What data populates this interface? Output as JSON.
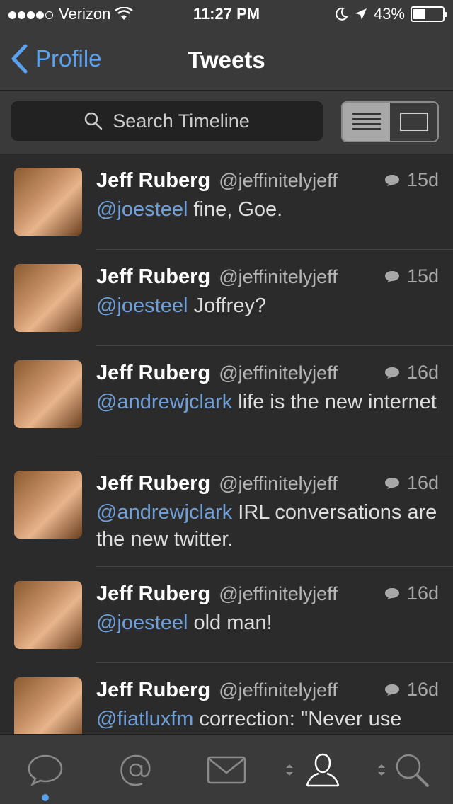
{
  "status_bar": {
    "carrier": "Verizon",
    "time": "11:27 PM",
    "battery": "43%",
    "battery_level": 0.43,
    "icons": [
      "signal-dots-icon",
      "wifi-icon",
      "moon-icon",
      "location-arrow-icon",
      "battery-icon"
    ]
  },
  "nav": {
    "back_label": "Profile",
    "title": "Tweets"
  },
  "search": {
    "placeholder": "Search Timeline"
  },
  "view_toggle": {
    "selected": "list"
  },
  "tweets": [
    {
      "name": "Jeff Ruberg",
      "handle": "@jeffinitelyjeff",
      "time": "15d",
      "mention": "@joesteel",
      "text": " fine, Goe."
    },
    {
      "name": "Jeff Ruberg",
      "handle": "@jeffinitelyjeff",
      "time": "15d",
      "mention": "@joesteel",
      "text": " Joffrey?"
    },
    {
      "name": "Jeff Ruberg",
      "handle": "@jeffinitelyjeff",
      "time": "16d",
      "mention": "@andrewjclark",
      "text": " life is the new internet"
    },
    {
      "name": "Jeff Ruberg",
      "handle": "@jeffinitelyjeff",
      "time": "16d",
      "mention": "@andrewjclark",
      "text": " IRL conversations are the new twitter."
    },
    {
      "name": "Jeff Ruberg",
      "handle": "@jeffinitelyjeff",
      "time": "16d",
      "mention": "@joesteel",
      "text": " old man!"
    },
    {
      "name": "Jeff Ruberg",
      "handle": "@jeffinitelyjeff",
      "time": "16d",
      "mention": "@fiatluxfm",
      "text": " correction: \"Never use"
    }
  ],
  "tab_bar": {
    "tabs": [
      "timeline-tab",
      "mentions-tab",
      "messages-tab",
      "profile-tab",
      "search-tab"
    ],
    "selected": "profile-tab"
  },
  "colors": {
    "accent": "#5aa1f0",
    "mention": "#6f9fd8",
    "background": "#2b2b2b",
    "bar": "#3a3a3a"
  }
}
